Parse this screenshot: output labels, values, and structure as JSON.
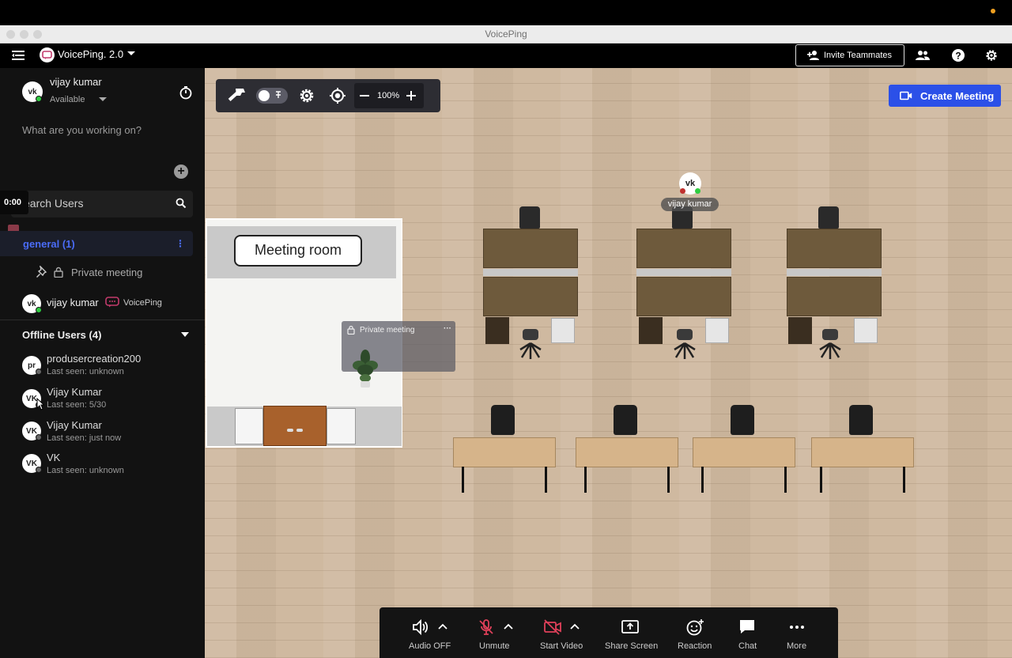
{
  "window": {
    "title": "VoicePing"
  },
  "header": {
    "workspace_name": "VoicePing. 2.0",
    "invite_label": "Invite Teammates"
  },
  "sidebar": {
    "user": {
      "initials": "vk",
      "name": "vijay kumar",
      "status": "Available"
    },
    "working_on_placeholder": "What are you working on?",
    "recording_time": "0:00",
    "search_placeholder": "earch Users",
    "channel": {
      "name": "general (1)"
    },
    "private_meeting_label": "Private meeting",
    "member": {
      "initials": "vk",
      "name": "vijay kumar",
      "app": "VoicePing"
    },
    "offline_header": "Offline Users (4)",
    "offline_users": [
      {
        "initials": "pr",
        "name": "produsercreation200",
        "last_seen": "Last seen: unknown"
      },
      {
        "initials": "VK",
        "name": "Vijay Kumar",
        "last_seen": "Last seen: 5/30"
      },
      {
        "initials": "VK",
        "name": "Vijay Kumar",
        "last_seen": "Last seen: just now"
      },
      {
        "initials": "VK",
        "name": "VK",
        "last_seen": "Last seen: unknown"
      }
    ]
  },
  "canvas": {
    "zoom": "100%",
    "create_meeting_label": "Create Meeting",
    "meeting_room_label": "Meeting room",
    "private_meeting_card": "Private meeting",
    "avatar": {
      "initials": "vk",
      "name": "vijay kumar"
    }
  },
  "controls": {
    "audio": "Audio OFF",
    "mic": "Unmute",
    "video": "Start Video",
    "share": "Share Screen",
    "reaction": "Reaction",
    "chat": "Chat",
    "more": "More"
  },
  "colors": {
    "accent_blue": "#2b50e8",
    "channel_blue": "#4a6cf7",
    "danger_red": "#e0405a",
    "online_green": "#2ecc40"
  }
}
